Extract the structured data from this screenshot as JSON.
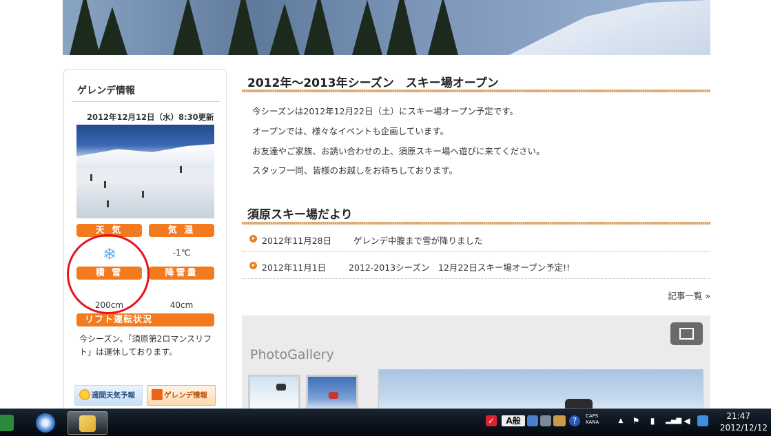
{
  "sidebar": {
    "title": "ゲレンデ情報",
    "update": "2012年12月12日（水）8:30更新",
    "weather_label": "天 気",
    "temp_label": "気 温",
    "temp_value": "-1℃",
    "snow_depth_label": "積 雪",
    "snowfall_label": "降雪量",
    "snow_depth_value": "200cm",
    "snowfall_value": "40cm",
    "weather_icon": "snowflake-icon",
    "lift_label": "リフト運転状況",
    "lift_text": "今シーズン、「須原第2ロマンスリフト」は運休しております。",
    "banner_weather": "週間天気予報",
    "banner_gelande": "ゲレンデ情報"
  },
  "main": {
    "season_title": "2012年〜2013年シーズン　スキー場オープン",
    "paragraphs": [
      "今シーズンは2012年12月22日（土）にスキー場オープン予定です。",
      "オープンでは、様々なイベントも企画しています。",
      "お友達やご家族、お誘い合わせの上、須原スキー場へ遊びに来てください。",
      "スタッフ一同、皆様のお越しをお待ちしております。"
    ],
    "news_title": "須原スキー場だより",
    "news": [
      {
        "date": "2012年11月28日",
        "title": "ゲレンデ中腹まで雪が降りました"
      },
      {
        "date": "2012年11月1日",
        "title": "2012-2013シーズン　12月22日スキー場オープン予定!!"
      }
    ],
    "more_link": "記事一覧 »",
    "gallery_title": "PhotoGallery"
  },
  "taskbar": {
    "caps": "CAPS",
    "kana": "KANA",
    "ime": "A般",
    "time": "21:47",
    "date": "2012/12/12"
  },
  "colors": {
    "accent": "#f47a1f",
    "annotation": "#e3141e"
  }
}
